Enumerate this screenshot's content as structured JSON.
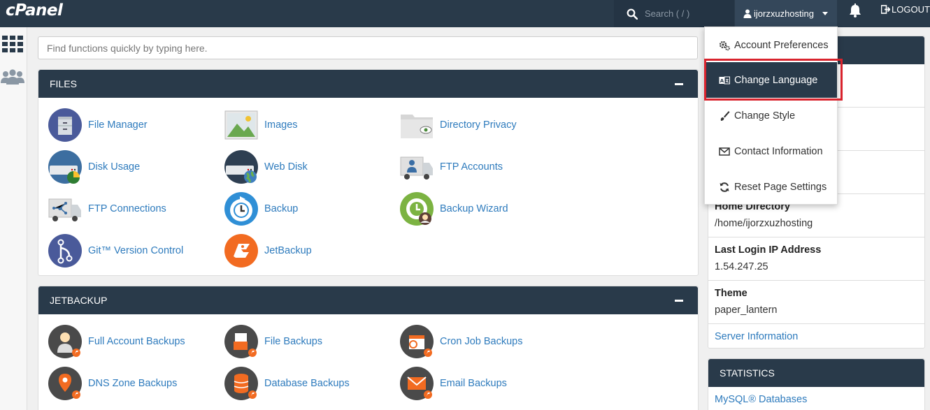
{
  "topbar": {
    "logo": "cPanel",
    "search_placeholder": "Search ( / )",
    "username": "ijorzxuzhosting",
    "logout_label": "LOGOUT"
  },
  "quickfind": {
    "placeholder": "Find functions quickly by typing here."
  },
  "files": {
    "title": "FILES",
    "items": [
      {
        "label": "File Manager",
        "icon": "file-manager-icon"
      },
      {
        "label": "Images",
        "icon": "images-icon"
      },
      {
        "label": "Directory Privacy",
        "icon": "directory-privacy-icon"
      },
      {
        "label": "Disk Usage",
        "icon": "disk-usage-icon"
      },
      {
        "label": "Web Disk",
        "icon": "web-disk-icon"
      },
      {
        "label": "FTP Accounts",
        "icon": "ftp-accounts-icon"
      },
      {
        "label": "FTP Connections",
        "icon": "ftp-connections-icon"
      },
      {
        "label": "Backup",
        "icon": "backup-icon"
      },
      {
        "label": "Backup Wizard",
        "icon": "backup-wizard-icon"
      },
      {
        "label": "Git™ Version Control",
        "icon": "git-icon"
      },
      {
        "label": "JetBackup",
        "icon": "jetbackup-icon"
      }
    ]
  },
  "jetbackup": {
    "title": "JETBACKUP",
    "items": [
      {
        "label": "Full Account Backups",
        "icon": "full-account-backups-icon"
      },
      {
        "label": "File Backups",
        "icon": "file-backups-icon"
      },
      {
        "label": "Cron Job Backups",
        "icon": "cron-job-backups-icon"
      },
      {
        "label": "DNS Zone Backups",
        "icon": "dns-zone-backups-icon"
      },
      {
        "label": "Database Backups",
        "icon": "database-backups-icon"
      },
      {
        "label": "Email Backups",
        "icon": "email-backups-icon"
      }
    ]
  },
  "general_info": {
    "home_directory_label": "Home Directory",
    "home_directory_value": "/home/ijorzxuzhosting",
    "last_login_label": "Last Login IP Address",
    "last_login_value": "1.54.247.25",
    "theme_label": "Theme",
    "theme_value": "paper_lantern",
    "server_info_link": "Server Information"
  },
  "statistics": {
    "title": "STATISTICS",
    "first_item": "MySQL® Databases"
  },
  "user_dropdown": {
    "items": [
      {
        "label": "Account Preferences",
        "icon": "gears-icon"
      },
      {
        "label": "Change Language",
        "icon": "language-icon",
        "active": true
      },
      {
        "label": "Change Style",
        "icon": "paintbrush-icon"
      },
      {
        "label": "Contact Information",
        "icon": "envelope-icon"
      },
      {
        "label": "Reset Page Settings",
        "icon": "refresh-icon"
      }
    ]
  },
  "colors": {
    "header_bg": "#293a4a",
    "link": "#2e7bbd",
    "highlight": "#d9232d"
  }
}
